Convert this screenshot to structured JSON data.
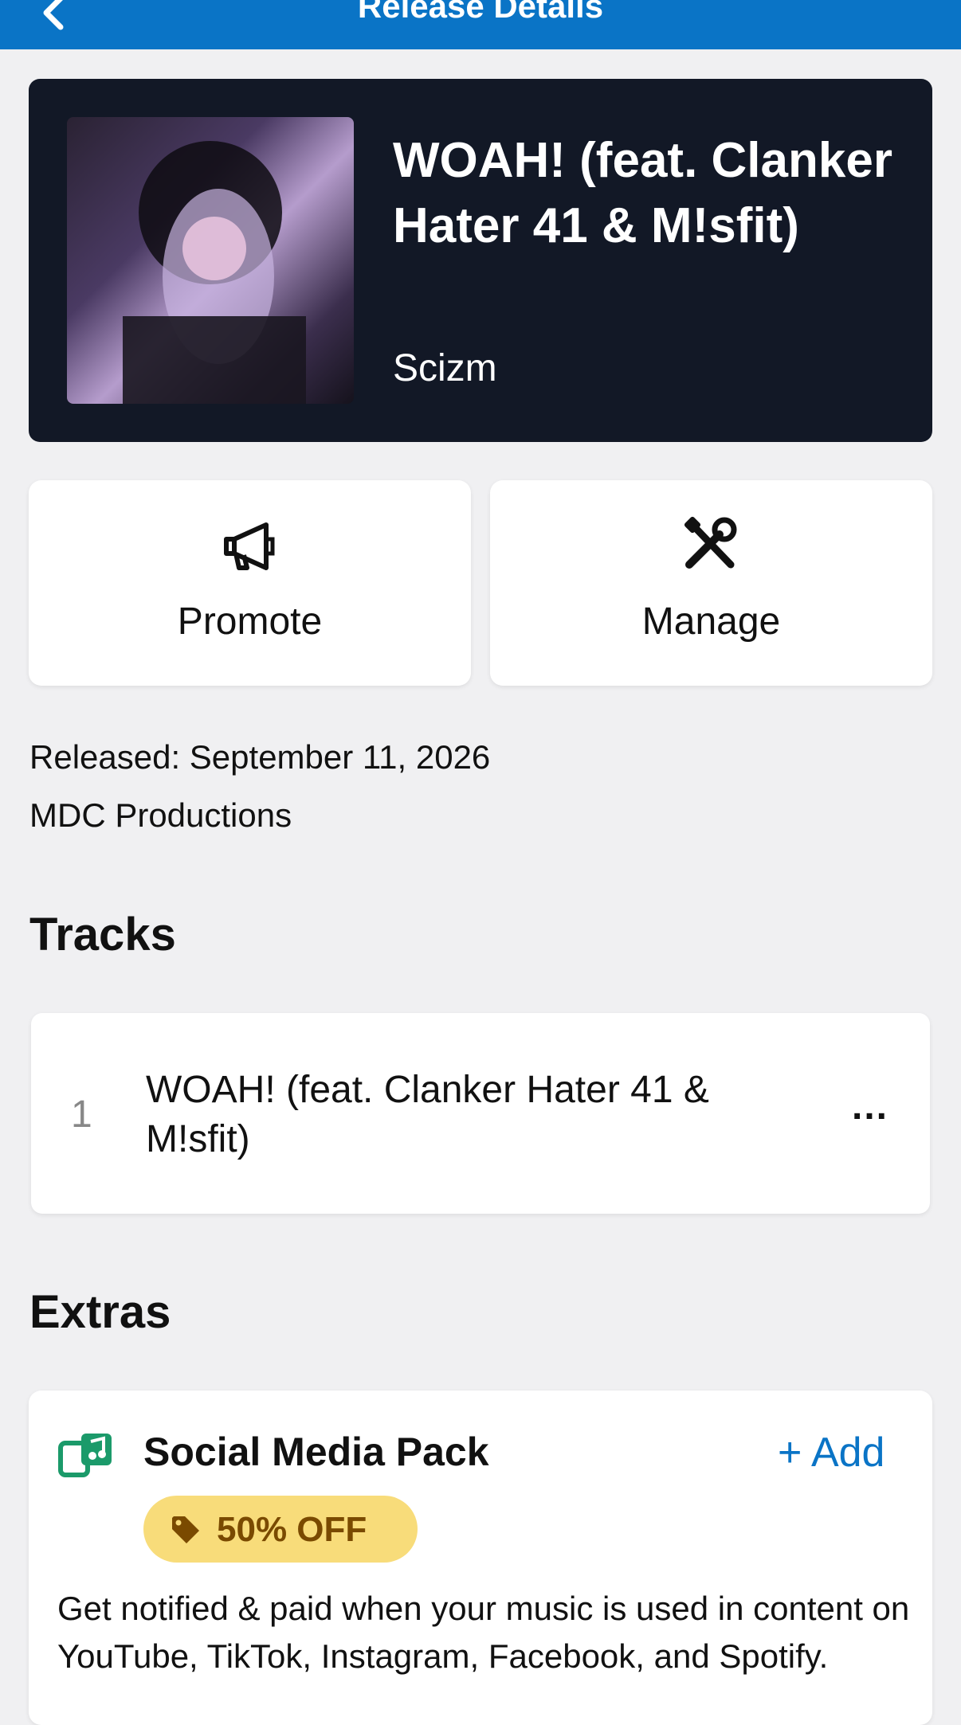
{
  "header": {
    "title": "Release Details"
  },
  "release": {
    "title": "WOAH! (feat. Clanker Hater 41 & M!sfit)",
    "artist": "Scizm",
    "released": "Released: September 11, 2026",
    "label": "MDC Productions"
  },
  "actions": {
    "promote": "Promote",
    "manage": "Manage"
  },
  "sections": {
    "tracks": "Tracks",
    "extras": "Extras"
  },
  "tracks": [
    {
      "number": "1",
      "title": "WOAH! (feat. Clanker Hater 41 & M!sfit)",
      "more": "..."
    }
  ],
  "extras": [
    {
      "name": "Social Media Pack",
      "add": "+ Add",
      "badge": "50% OFF",
      "description": "Get notified & paid when your music is used in content on YouTube, TikTok, Instagram, Facebook, and Spotify."
    }
  ],
  "icons": {
    "back": "chevron-left-icon",
    "promote": "megaphone-icon",
    "manage": "tools-icon",
    "extra": "social-music-icon",
    "badge": "tag-icon"
  },
  "colors": {
    "header": "#0a74c6",
    "card_dark": "#121826",
    "accent": "#0a74c6",
    "badge_bg": "#f8dc7a",
    "badge_text": "#7a4a00",
    "extra_icon": "#1b9a6a"
  }
}
